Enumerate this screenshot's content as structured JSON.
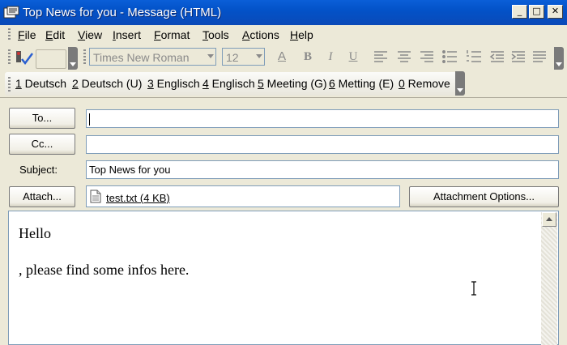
{
  "window": {
    "title": "Top News for you - Message (HTML)",
    "controls": {
      "minimize": "_",
      "maximize": "□",
      "close": "✕"
    }
  },
  "menubar": {
    "items": [
      {
        "key": "F",
        "rest": "ile"
      },
      {
        "key": "E",
        "rest": "dit"
      },
      {
        "key": "V",
        "rest": "iew"
      },
      {
        "key": "I",
        "rest": "nsert"
      },
      {
        "key": "F",
        "rest": "ormat",
        "keyfirst": false
      },
      {
        "key": "T",
        "rest": "ools"
      },
      {
        "key": "A",
        "rest": "ctions"
      },
      {
        "key": "H",
        "rest": "elp"
      }
    ]
  },
  "format_toolbar": {
    "font": "Times New Roman",
    "size": "12",
    "buttons": [
      "A",
      "B",
      "I",
      "U"
    ]
  },
  "custom_toolbar": {
    "items": [
      {
        "num": "1",
        "label": " Deutsch"
      },
      {
        "num": "2",
        "label": " Deutsch (U)"
      },
      {
        "num": "3",
        "label": " Englisch"
      },
      {
        "num": "4",
        "label": " Englisch"
      },
      {
        "num": "5",
        "label": " Meeting (G)"
      },
      {
        "num": "6",
        "label": " Metting (E)"
      },
      {
        "num": "0",
        "label": " Remove"
      }
    ]
  },
  "header": {
    "to_button": "To...",
    "cc_button": "Cc...",
    "subject_label": "Subject:",
    "subject_value": "Top News for you",
    "attach_button": "Attach...",
    "attachment": "test.txt (4 KB)",
    "attachment_options": "Attachment Options..."
  },
  "body": {
    "line1": "Hello",
    "line2": ", please find some infos here."
  }
}
